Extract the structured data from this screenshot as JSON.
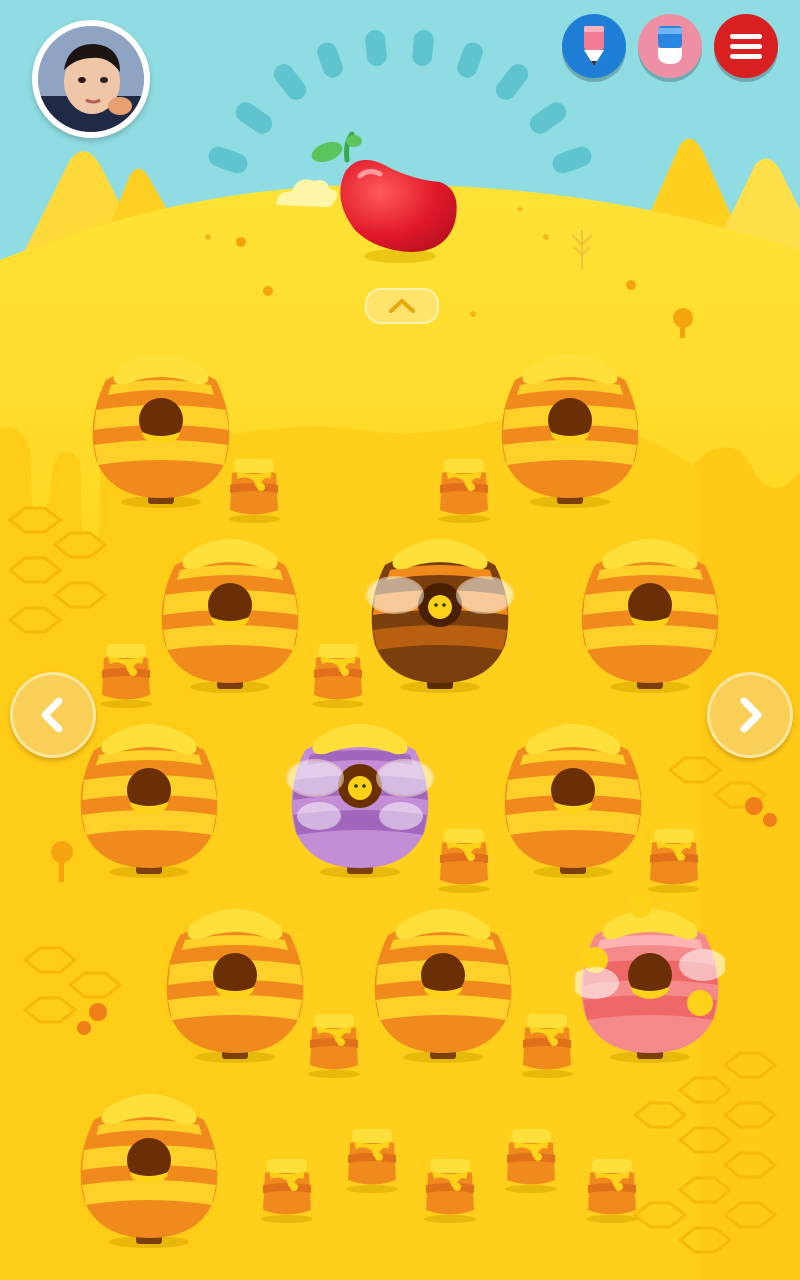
{
  "profile": {
    "avatar": "child-photo-avatar"
  },
  "toolbar": [
    {
      "id": "pencil",
      "icon": "pencil-icon",
      "color": "#1f7fd6"
    },
    {
      "id": "eraser",
      "icon": "eraser-icon",
      "color": "#ef8fa3"
    },
    {
      "id": "menu",
      "icon": "hamburger-menu-icon",
      "color": "#d92020"
    }
  ],
  "colors": {
    "sky": "#8fdde3",
    "honey": "#ffd21a",
    "hive_orange": "#f08a1c",
    "hive_yellow": "#ffcf2a",
    "hive_brown": "#7a3f0c",
    "hive_purple": "#b07acb",
    "hive_pink": "#f27c7c",
    "bean": "#e0182a"
  },
  "scene": {
    "reward": "red-jelly-bean",
    "scroll_up_icon": "chevron-up-icon",
    "nav_prev_icon": "chevron-left-icon",
    "nav_next_icon": "chevron-right-icon"
  },
  "hives": [
    {
      "id": "hive-1",
      "style": "yellow-orange",
      "occupied": false
    },
    {
      "id": "hive-2",
      "style": "yellow-orange",
      "occupied": false
    },
    {
      "id": "hive-3",
      "style": "yellow-orange",
      "occupied": false
    },
    {
      "id": "hive-4",
      "style": "brown",
      "occupied": true
    },
    {
      "id": "hive-5",
      "style": "yellow-orange",
      "occupied": false
    },
    {
      "id": "hive-6",
      "style": "yellow-orange",
      "occupied": false
    },
    {
      "id": "hive-7",
      "style": "purple",
      "occupied": true
    },
    {
      "id": "hive-8",
      "style": "yellow-orange",
      "occupied": false
    },
    {
      "id": "hive-9",
      "style": "yellow-orange",
      "occupied": false
    },
    {
      "id": "hive-10",
      "style": "yellow-orange",
      "occupied": false
    },
    {
      "id": "hive-11",
      "style": "pink",
      "occupied": true
    },
    {
      "id": "hive-12",
      "style": "yellow-orange",
      "occupied": false
    }
  ],
  "honey_pots": 13
}
